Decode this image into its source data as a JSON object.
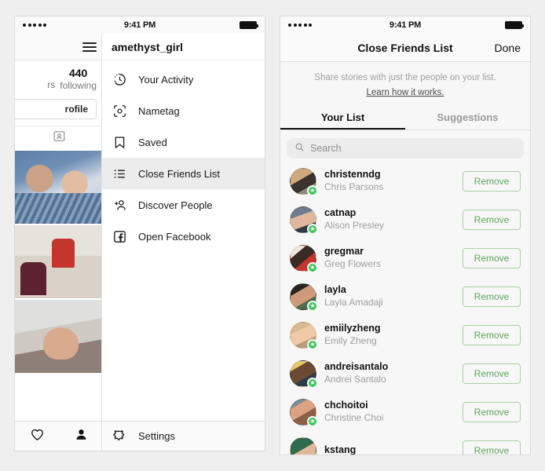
{
  "status_bar": {
    "time": "9:41 PM",
    "signal_dots": 5
  },
  "left_phone": {
    "header": {
      "username": "amethyst_girl",
      "menu_icon": "hamburger-icon"
    },
    "profile": {
      "following_count": "440",
      "following_label": "following",
      "followers_label_cut": "rs",
      "edit_profile_label_cut": "rofile",
      "tab_icon": "nametag-tab-icon"
    },
    "menu": {
      "items": [
        {
          "label": "Your Activity",
          "icon": "clock-activity-icon",
          "active": false
        },
        {
          "label": "Nametag",
          "icon": "nametag-icon",
          "active": false
        },
        {
          "label": "Saved",
          "icon": "bookmark-icon",
          "active": false
        },
        {
          "label": "Close Friends List",
          "icon": "list-icon",
          "active": true
        },
        {
          "label": "Discover People",
          "icon": "add-person-icon",
          "active": false
        },
        {
          "label": "Open Facebook",
          "icon": "facebook-icon",
          "active": false
        }
      ],
      "footer": {
        "label": "Settings",
        "icon": "gear-icon"
      }
    },
    "bottom_bar": {
      "heart_icon": "heart-icon",
      "profile_icon": "person-filled-icon"
    }
  },
  "right_phone": {
    "nav": {
      "title": "Close Friends List",
      "done_label": "Done"
    },
    "blurb": {
      "text": "Share stories with just the people on your list.",
      "link": "Learn how it works."
    },
    "tabs": [
      {
        "label": "Your List",
        "active": true
      },
      {
        "label": "Suggestions",
        "active": false
      }
    ],
    "search": {
      "placeholder": "Search",
      "value": "",
      "icon": "search-icon"
    },
    "remove_label": "Remove",
    "friends": [
      {
        "username": "christenndg",
        "name": "Chris Parsons",
        "badge": "close-friend-star"
      },
      {
        "username": "catnap",
        "name": "Alison Presley",
        "badge": "close-friend-star"
      },
      {
        "username": "gregmar",
        "name": "Greg Flowers",
        "badge": "close-friend-star"
      },
      {
        "username": "layla",
        "name": "Layla Amadaji",
        "badge": "close-friend-star"
      },
      {
        "username": "emiilyzheng",
        "name": "Emily Zheng",
        "badge": "close-friend-star"
      },
      {
        "username": "andreisantalo",
        "name": "Andrei Santalo",
        "badge": "close-friend-star"
      },
      {
        "username": "chchoitoi",
        "name": "Christine Choi",
        "badge": "close-friend-star"
      },
      {
        "username": "kstang",
        "name": "",
        "badge": "close-friend-star"
      }
    ]
  },
  "colors": {
    "page_bg": "#efefef",
    "panel_bg": "#ffffff",
    "list_bg": "#f7f7f7",
    "accent_green": "#3ec65c",
    "remove_green": "#5ea85a",
    "remove_border": "#a8d3a0",
    "muted_text": "#9e9e9e"
  }
}
